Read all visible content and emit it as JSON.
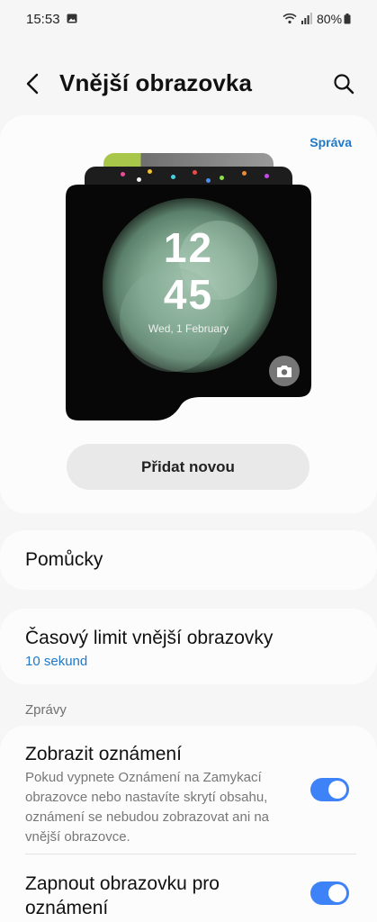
{
  "status_bar": {
    "time": "15:53",
    "battery": "80%",
    "icons": [
      "photo-icon",
      "wifi-icon",
      "signal-icon",
      "battery-icon"
    ]
  },
  "header": {
    "title": "Vnější obrazovka",
    "back_icon": "back-arrow-icon",
    "search_icon": "search-icon"
  },
  "preview": {
    "manage_label": "Správa",
    "clock_hour": "12",
    "clock_minute": "45",
    "clock_date": "Wed, 1 February",
    "camera_icon": "camera-icon",
    "add_new_label": "Přidat novou"
  },
  "widgets": {
    "label": "Pomůcky"
  },
  "timeout": {
    "label": "Časový limit vnější obrazovky",
    "value": "10 sekund"
  },
  "messages_section": {
    "header": "Zprávy",
    "show_notifications": {
      "title": "Zobrazit oznámení",
      "description": "Pokud vypnete Oznámení na Zamykací obrazovce nebo nastavíte skrytí obsahu, oznámení se nebudou zobrazovat ani na vnější obrazovce.",
      "enabled": true
    },
    "wake_screen": {
      "title": "Zapnout obrazovku pro oznámení",
      "enabled": true
    }
  },
  "colors": {
    "accent": "#3e82f7",
    "link": "#1f78c8",
    "background": "#f6f6f6",
    "card": "#fcfcfc"
  }
}
